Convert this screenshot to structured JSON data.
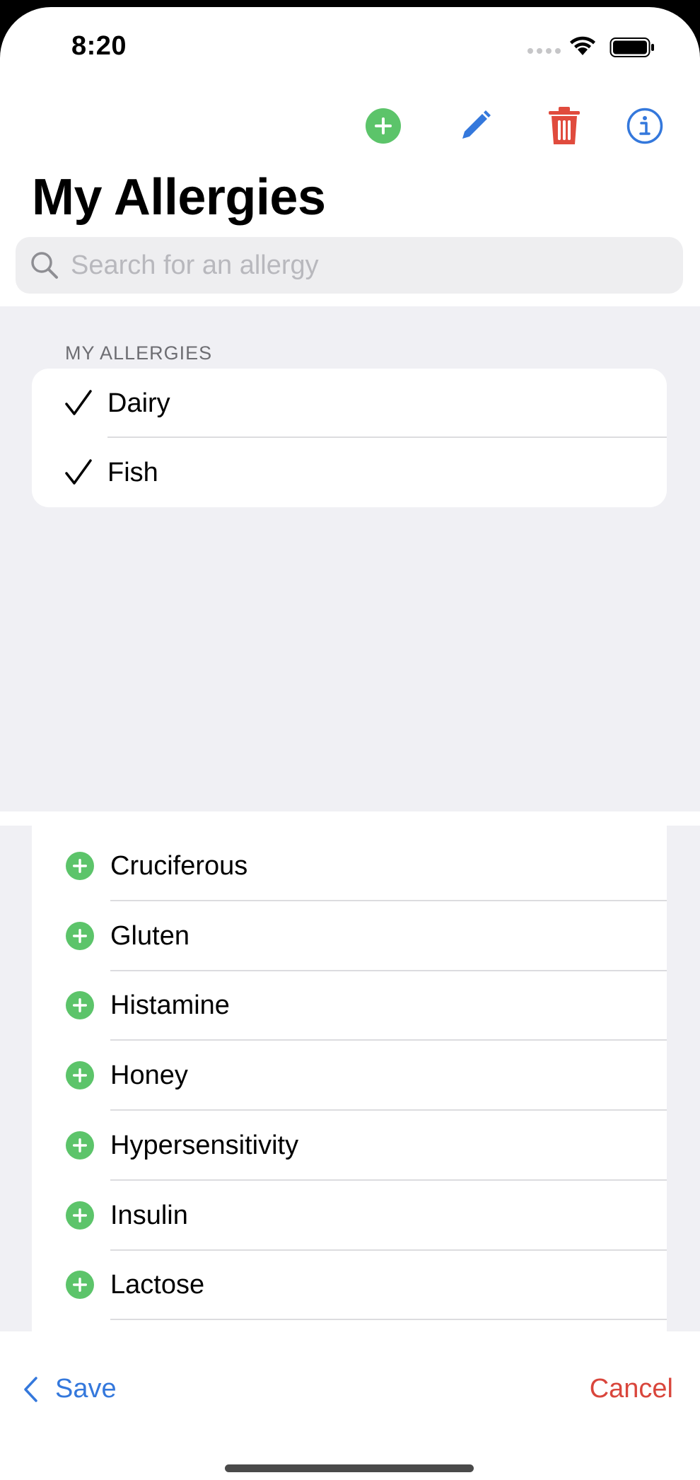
{
  "status_bar": {
    "time": "8:20"
  },
  "toolbar": {
    "add_icon": "plus-circle-icon",
    "edit_icon": "pencil-icon",
    "delete_icon": "trash-icon",
    "info_icon": "info-circle-icon"
  },
  "title": "My Allergies",
  "search": {
    "placeholder": "Search for an allergy",
    "value": ""
  },
  "my_allergies": {
    "header": "MY ALLERGIES",
    "items": [
      {
        "label": "Dairy"
      },
      {
        "label": "Fish"
      }
    ]
  },
  "available_allergies": [
    {
      "label": "Cruciferous"
    },
    {
      "label": "Gluten"
    },
    {
      "label": "Histamine"
    },
    {
      "label": "Honey"
    },
    {
      "label": "Hypersensitivity"
    },
    {
      "label": "Insulin"
    },
    {
      "label": "Lactose"
    }
  ],
  "bottom_bar": {
    "save_label": "Save",
    "cancel_label": "Cancel"
  },
  "colors": {
    "accent_blue": "#3478dc",
    "add_green": "#5cc46a",
    "delete_red": "#e04b3d",
    "cancel_red": "#d9463c",
    "grouped_background": "#f0f0f4"
  }
}
